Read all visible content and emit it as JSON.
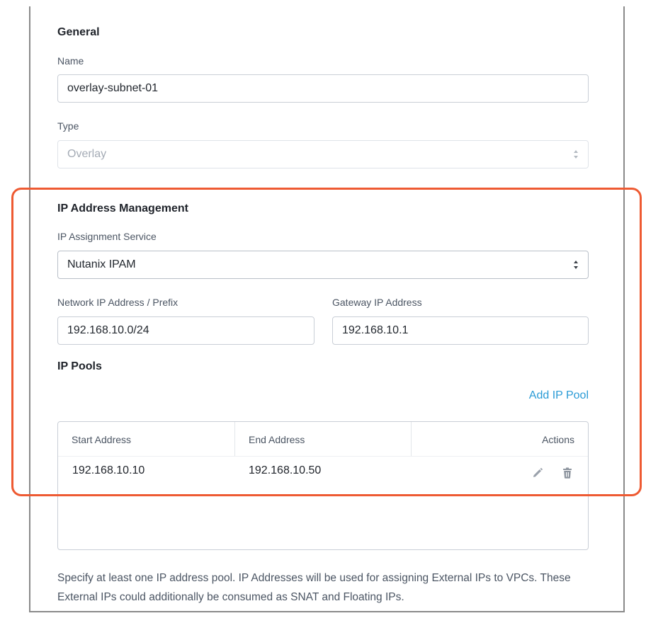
{
  "general": {
    "title": "General",
    "name_label": "Name",
    "name_value": "overlay-subnet-01",
    "type_label": "Type",
    "type_value": "Overlay"
  },
  "ipam": {
    "title": "IP Address Management",
    "service_label": "IP Assignment Service",
    "service_value": "Nutanix IPAM",
    "network_label": "Network IP Address / Prefix",
    "network_value": "192.168.10.0/24",
    "gateway_label": "Gateway IP Address",
    "gateway_value": "192.168.10.1"
  },
  "pools": {
    "title": "IP Pools",
    "add_label": "Add IP Pool",
    "columns": [
      "Start Address",
      "End Address",
      "Actions"
    ],
    "rows": [
      {
        "start": "192.168.10.10",
        "end": "192.168.10.50"
      }
    ],
    "actions": [
      "pencil-icon",
      "trash-icon"
    ]
  },
  "help_text": "Specify at least one IP address pool. IP Addresses will be used for assigning External IPs to VPCs. These External IPs could additionally be consumed as SNAT and Floating IPs.",
  "colors": {
    "accent": "#2a9bd6",
    "highlight": "#ee5a32"
  }
}
